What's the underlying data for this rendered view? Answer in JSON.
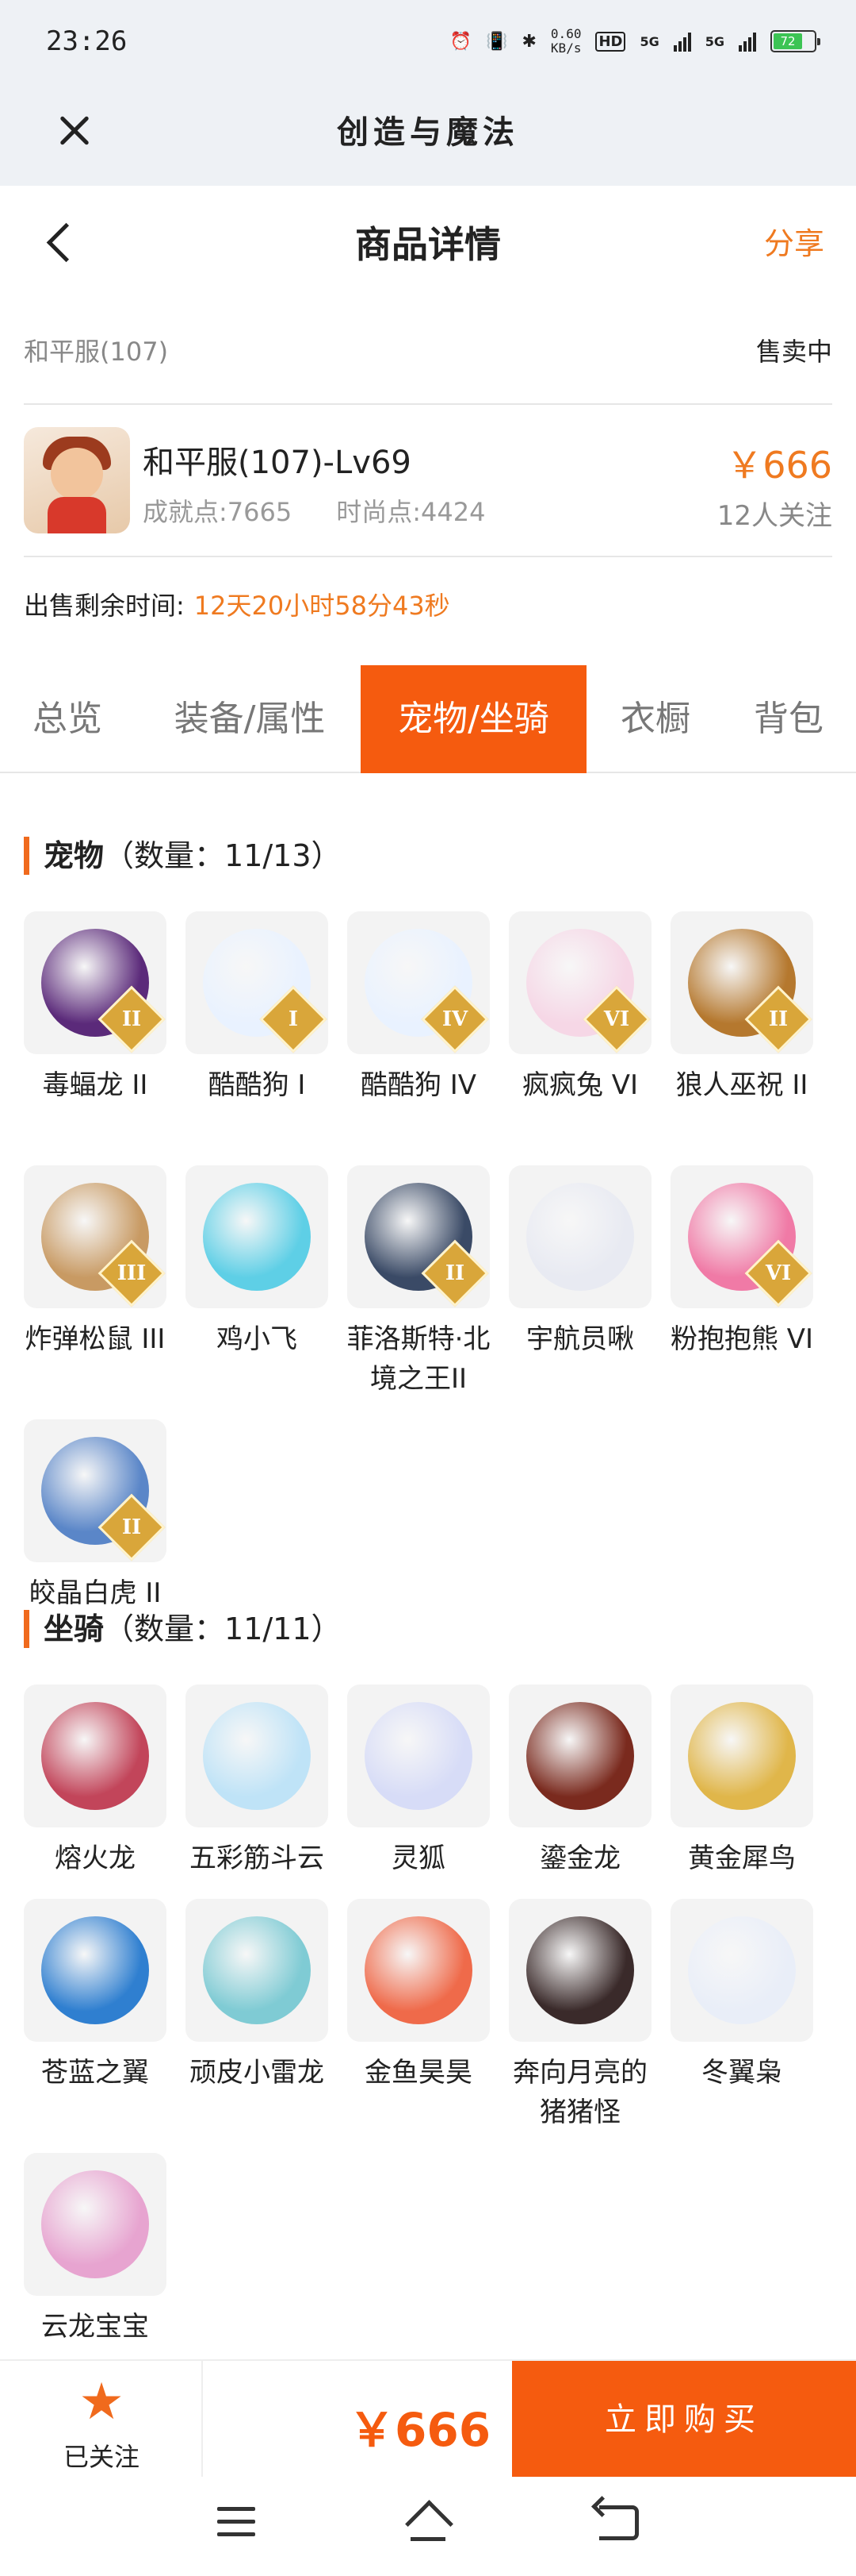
{
  "status_bar": {
    "time": "23:26",
    "net_speed_top": "0.60",
    "net_speed_unit": "KB/s",
    "battery": "72",
    "hd_label": "HD",
    "signal_1": "5G",
    "signal_2": "5G"
  },
  "app": {
    "title": "创造与魔法"
  },
  "page": {
    "title": "商品详情",
    "share_label": "分享"
  },
  "server": {
    "name": "和平服(107)",
    "status": "售卖中"
  },
  "product": {
    "name": "和平服(107)-Lv69",
    "achievement": "成就点:7665",
    "fashion": "时尚点:4424",
    "price": "￥666",
    "followers": "12人关注"
  },
  "timer": {
    "label": "出售剩余时间:",
    "value": "12天20小时58分43秒"
  },
  "tabs": [
    {
      "label": "总览"
    },
    {
      "label": "装备/属性"
    },
    {
      "label": "宠物/坐骑"
    },
    {
      "label": "衣橱"
    },
    {
      "label": "背包"
    }
  ],
  "pets_section": {
    "title": "宠物",
    "count": "（数量：11/13）",
    "items": [
      {
        "label": "毒蝠龙 II",
        "badge": "II",
        "color": "#5b2a7a"
      },
      {
        "label": "酷酷狗 I",
        "badge": "I",
        "color": "#e9f2ff"
      },
      {
        "label": "酷酷狗 IV",
        "badge": "IV",
        "color": "#e9f2ff"
      },
      {
        "label": "疯疯兔 VI",
        "badge": "VI",
        "color": "#f6d7e6"
      },
      {
        "label": "狼人巫祝 II",
        "badge": "II",
        "color": "#b5782e"
      },
      {
        "label": "炸弹松鼠 III",
        "badge": "III",
        "color": "#c89a63"
      },
      {
        "label": "鸡小飞",
        "badge": "",
        "color": "#5ecfe6"
      },
      {
        "label": "菲洛斯特·北境之王II",
        "badge": "II",
        "color": "#3a4a66"
      },
      {
        "label": "宇航员啾",
        "badge": "",
        "color": "#e8eaf2"
      },
      {
        "label": "粉抱抱熊 VI",
        "badge": "VI",
        "color": "#f07aa6"
      },
      {
        "label": "皎晶白虎 II",
        "badge": "II",
        "color": "#5a86c8"
      }
    ]
  },
  "mounts_section": {
    "title": "坐骑",
    "count": "（数量：11/11）",
    "items": [
      {
        "label": "熔火龙",
        "color": "#c2455a"
      },
      {
        "label": "五彩筋斗云",
        "color": "#bfe3f7"
      },
      {
        "label": "灵狐",
        "color": "#d7dcf7"
      },
      {
        "label": "鎏金龙",
        "color": "#7a2a1e"
      },
      {
        "label": "黄金犀鸟",
        "color": "#e0b64a"
      },
      {
        "label": "苍蓝之翼",
        "color": "#2f7fd0"
      },
      {
        "label": "顽皮小雷龙",
        "color": "#7fcbd4"
      },
      {
        "label": "金鱼昊昊",
        "color": "#ef6a4a"
      },
      {
        "label": "奔向月亮的猪猪怪",
        "color": "#3a2a2a"
      },
      {
        "label": "冬翼枭",
        "color": "#e9eef8"
      },
      {
        "label": "云龙宝宝",
        "color": "#e7a4d0"
      }
    ]
  },
  "bottom_bar": {
    "follow_label": "已关注",
    "price": "￥666",
    "buy_label": "立即购买"
  }
}
